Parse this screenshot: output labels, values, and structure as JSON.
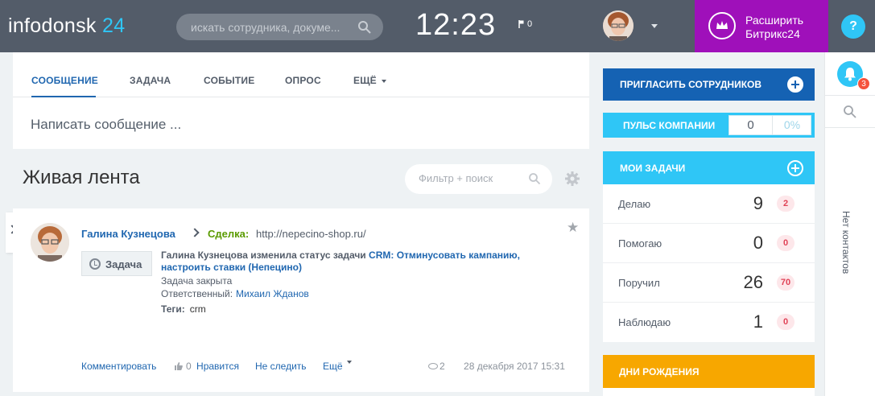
{
  "header": {
    "logo_main": "infodonsk",
    "logo_num": "24",
    "search_placeholder": "искать сотрудника, докуме...",
    "clock": "12:23",
    "flag_count": "0",
    "extend_line1": "Расширить",
    "extend_line2": "Битрикс24",
    "help": "?"
  },
  "composer": {
    "tabs": [
      "СООБЩЕНИЕ",
      "ЗАДАЧА",
      "СОБЫТИЕ",
      "ОПРОС",
      "ЕЩЁ"
    ],
    "placeholder": "Написать сообщение ..."
  },
  "feed": {
    "title": "Живая лента",
    "filter_placeholder": "Фильтр + поиск"
  },
  "post": {
    "author": "Галина Кузнецова",
    "deal_label": "Сделка:",
    "deal_url": "http://nepecino-shop.ru/",
    "badge": "Задача",
    "event_prefix": "Галина Кузнецова изменила статус задачи",
    "event_link": "CRM: Отминусовать кампанию, настроить ставки (Непецино)",
    "closed": "Задача закрыта",
    "responsible_label": "Ответственный:",
    "responsible": "Михаил Жданов",
    "tags_label": "Теги:",
    "tags": "crm",
    "comment": "Комментировать",
    "likes": "0",
    "like": "Нравится",
    "unfollow": "Не следить",
    "more": "Ещё",
    "views": "2",
    "date": "28 декабря 2017 15:31"
  },
  "right": {
    "invite": "ПРИГЛАСИТЬ СОТРУДНИКОВ",
    "pulse_label": "ПУЛЬС КОМПАНИИ",
    "pulse_value": "0",
    "pulse_percent": "0%",
    "tasks_title": "МОИ ЗАДАЧИ",
    "tasks": [
      {
        "name": "Делаю",
        "count": "9",
        "badge": "2"
      },
      {
        "name": "Помогаю",
        "count": "0",
        "badge": "0"
      },
      {
        "name": "Поручил",
        "count": "26",
        "badge": "70"
      },
      {
        "name": "Наблюдаю",
        "count": "1",
        "badge": "0"
      }
    ],
    "birthdays": "ДНИ РОЖДЕНИЯ"
  },
  "sidepanel": {
    "notif_count": "3",
    "no_contacts": "Нет контактов"
  },
  "colors": {
    "topbar": "#535c69",
    "accent": "#2fc6f6",
    "brand_purple": "#9f10ba",
    "link": "#2067b0",
    "birthday": "#f7a700"
  }
}
